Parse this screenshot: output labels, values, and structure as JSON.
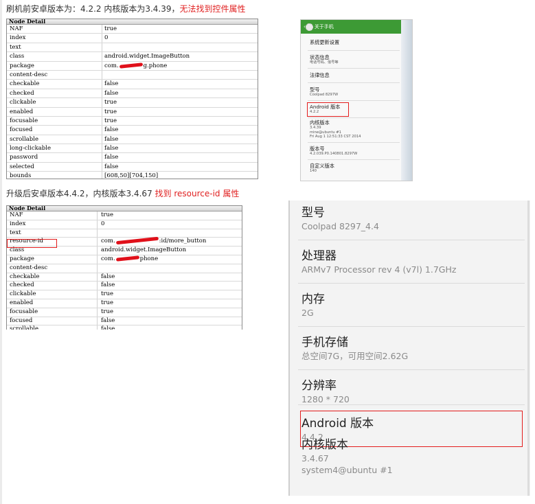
{
  "heading1": {
    "prefix": "刷机前安卓版本为：4.2.2 内核版本为3.4.39，",
    "red": "无法找到控件属性"
  },
  "heading2": {
    "prefix": "升级后安卓版本4.4.2，内核版本3.4.67 ",
    "red": "找到 resource-id 属性"
  },
  "colors": {
    "accent_red": "#e02020",
    "titlebar_green": "#3d9a35"
  },
  "table1": {
    "title": "Node Detail",
    "rows": [
      {
        "key": "NAF",
        "value": "true"
      },
      {
        "key": "index",
        "value": "0"
      },
      {
        "key": "text",
        "value": ""
      },
      {
        "key": "class",
        "value": "android.widget.ImageButton"
      },
      {
        "key": "package",
        "value_prefix": "com.",
        "value_suffix": "g.phone"
      },
      {
        "key": "content-desc",
        "value": ""
      },
      {
        "key": "checkable",
        "value": "false"
      },
      {
        "key": "checked",
        "value": "false"
      },
      {
        "key": "clickable",
        "value": "true"
      },
      {
        "key": "enabled",
        "value": "true"
      },
      {
        "key": "focusable",
        "value": "true"
      },
      {
        "key": "focused",
        "value": "false"
      },
      {
        "key": "scrollable",
        "value": "false"
      },
      {
        "key": "long-clickable",
        "value": "false"
      },
      {
        "key": "password",
        "value": "false"
      },
      {
        "key": "selected",
        "value": "false"
      },
      {
        "key": "bounds",
        "value": "[608,50][704,150]"
      }
    ]
  },
  "table2": {
    "title": "Node Detail",
    "rows": [
      {
        "key": "NAF",
        "value": "true"
      },
      {
        "key": "index",
        "value": "0"
      },
      {
        "key": "text",
        "value": ""
      },
      {
        "key": "resource-id",
        "value_prefix": "com.",
        "value_suffix": ":id/more_button"
      },
      {
        "key": "class",
        "value": "android.widget.ImageButton"
      },
      {
        "key": "package",
        "value_prefix": "com.",
        "value_suffix": "phone"
      },
      {
        "key": "content-desc",
        "value": ""
      },
      {
        "key": "checkable",
        "value": "false"
      },
      {
        "key": "checked",
        "value": "false"
      },
      {
        "key": "clickable",
        "value": "true"
      },
      {
        "key": "enabled",
        "value": "true"
      },
      {
        "key": "focusable",
        "value": "true"
      },
      {
        "key": "focused",
        "value": "false"
      },
      {
        "key": "scrollable",
        "value": "false"
      }
    ]
  },
  "phone1": {
    "title": "关于手机",
    "items": [
      {
        "title": "系统更新设置",
        "sub": ""
      },
      {
        "title": "状态信息",
        "sub": "电话号码、信号等"
      },
      {
        "title": "法律信息",
        "sub": ""
      },
      {
        "title": "型号",
        "sub": "Coolpad 8297W"
      },
      {
        "title": "Android 版本",
        "sub": "4.2.2"
      },
      {
        "title": "内核版本",
        "sub": "3.4.39",
        "sub2": "mine@ubuntu #1",
        "sub3": "Fri Aug 1 12:51:33 CST 2014"
      },
      {
        "title": "版本号",
        "sub": "4.2.039.P0.140801.8297W"
      },
      {
        "title": "自定义版本",
        "sub": "140"
      }
    ]
  },
  "phone2": {
    "items": [
      {
        "title": "型号",
        "sub": "Coolpad 8297_4.4"
      },
      {
        "title": "处理器",
        "sub": "ARMv7 Processor rev 4 (v7l)  1.7GHz"
      },
      {
        "title": "内存",
        "sub": "2G"
      },
      {
        "title": "手机存储",
        "sub": "总空间7G，可用空间2.62G"
      },
      {
        "title": "分辨率",
        "sub": "1280 * 720"
      },
      {
        "title": "Android 版本",
        "sub": "4.4.2"
      },
      {
        "title": "内核版本",
        "sub": "3.4.67",
        "sub2": "system4@ubuntu #1"
      }
    ]
  }
}
